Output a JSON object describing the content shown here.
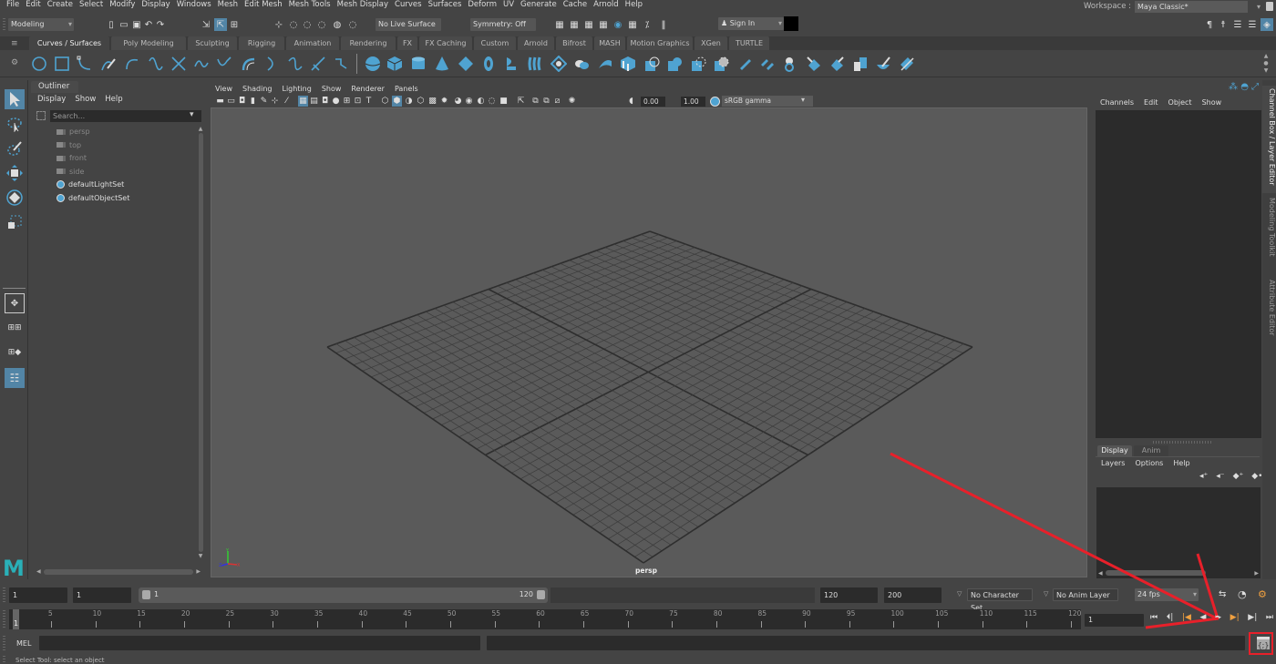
{
  "menubar": {
    "items": [
      "File",
      "Edit",
      "Create",
      "Select",
      "Modify",
      "Display",
      "Windows",
      "Mesh",
      "Edit Mesh",
      "Mesh Tools",
      "Mesh Display",
      "Curves",
      "Surfaces",
      "Deform",
      "UV",
      "Generate",
      "Cache",
      "Arnold",
      "Help"
    ]
  },
  "workspace": {
    "label": "Workspace :",
    "value": "Maya Classic*"
  },
  "statusline": {
    "menuset": "Modeling",
    "live_surface": "No Live Surface",
    "symmetry": "Symmetry: Off",
    "sign_in": "Sign In"
  },
  "shelf": {
    "tabs": [
      "Curves / Surfaces",
      "Poly Modeling",
      "Sculpting",
      "Rigging",
      "Animation",
      "Rendering",
      "FX",
      "FX Caching",
      "Custom",
      "Arnold",
      "Bifrost",
      "MASH",
      "Motion Graphics",
      "XGen",
      "TURTLE"
    ],
    "active_tab": "Curves / Surfaces",
    "accent": "#4fa3d1"
  },
  "outliner": {
    "title": "Outliner",
    "menus": [
      "Display",
      "Show",
      "Help"
    ],
    "search_placeholder": "Search...",
    "items": [
      {
        "label": "persp",
        "type": "camera",
        "dim": true
      },
      {
        "label": "top",
        "type": "camera",
        "dim": true
      },
      {
        "label": "front",
        "type": "camera",
        "dim": true
      },
      {
        "label": "side",
        "type": "camera",
        "dim": true
      },
      {
        "label": "defaultLightSet",
        "type": "set",
        "dim": false
      },
      {
        "label": "defaultObjectSet",
        "type": "set",
        "dim": false
      }
    ]
  },
  "viewport": {
    "menus": [
      "View",
      "Shading",
      "Lighting",
      "Show",
      "Renderer",
      "Panels"
    ],
    "exposure": "0.00",
    "gamma": "1.00",
    "color_space": "sRGB gamma",
    "camera_label": "persp",
    "background": "#5a5a5a"
  },
  "channelbox": {
    "menus": [
      "Channels",
      "Edit",
      "Object",
      "Show"
    ]
  },
  "layereditor": {
    "tabs": [
      "Display",
      "Anim"
    ],
    "active_tab": "Display",
    "menus": [
      "Layers",
      "Options",
      "Help"
    ]
  },
  "sidetabs": [
    "Channel Box / Layer Editor",
    "Modeling Toolkit",
    "Attribute Editor"
  ],
  "range": {
    "start": "1",
    "playback_start": "1",
    "slider_start": "1",
    "slider_end": "120",
    "playback_end": "120",
    "end": "200",
    "character_set": "No Character Set",
    "anim_layer": "No Anim Layer",
    "fps": "24 fps"
  },
  "timeline": {
    "current_frame": "1",
    "ticks": [
      "5",
      "10",
      "15",
      "20",
      "25",
      "30",
      "35",
      "40",
      "45",
      "50",
      "55",
      "60",
      "65",
      "70",
      "75",
      "80",
      "85",
      "90",
      "95",
      "100",
      "105",
      "110",
      "115",
      "120"
    ],
    "first": "1",
    "current_frame_field": "1"
  },
  "commandline": {
    "language": "MEL",
    "input": "",
    "result": ""
  },
  "helpline": {
    "text": "Select Tool: select an object"
  },
  "annotation": {
    "color": "#e8202a"
  }
}
